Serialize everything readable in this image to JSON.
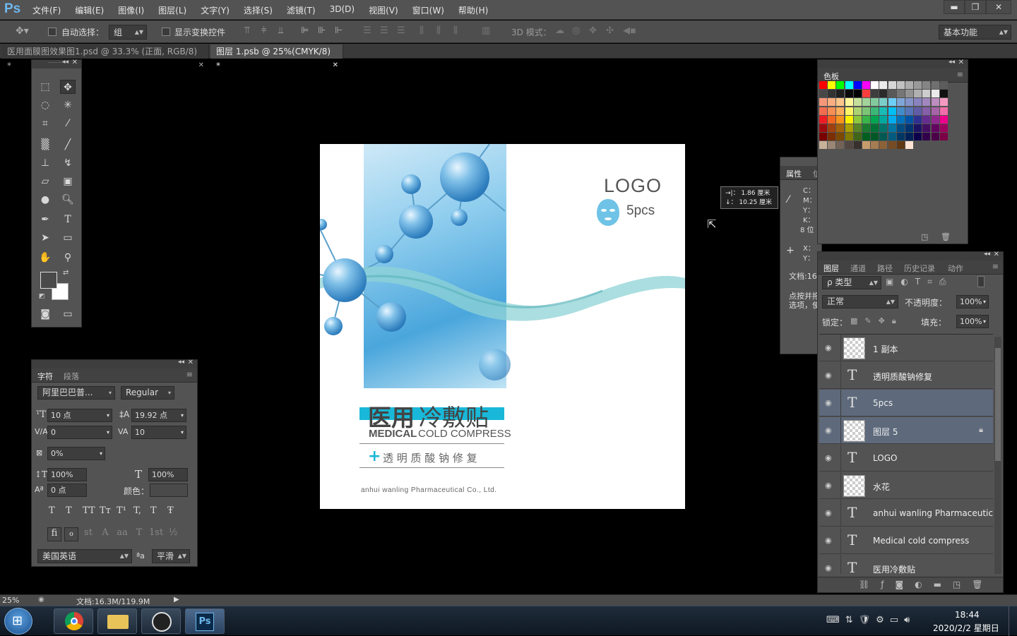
{
  "app": {
    "logo": "Ps",
    "menus": [
      "文件(F)",
      "编辑(E)",
      "图像(I)",
      "图层(L)",
      "文字(Y)",
      "选择(S)",
      "滤镜(T)",
      "3D(D)",
      "视图(V)",
      "窗口(W)",
      "帮助(H)"
    ],
    "win_min": "▬",
    "win_max": "❐",
    "win_close": "✕"
  },
  "options": {
    "auto_select": "自动选择：",
    "auto_select_value": "组",
    "show_transform": "显示变换控件",
    "mode_3d": "3D 模式：",
    "workspace": "基本功能"
  },
  "tabs": [
    {
      "label": "医用面膜图效果图1.psd @ 33.3% (正面, RGB/8) *",
      "close": "✕"
    },
    {
      "label": "图层 1.psb @ 25%(CMYK/8) *",
      "close": "✕"
    }
  ],
  "canvas": {
    "logo": "LOGO",
    "pcs": "5pcs",
    "title_bold": "医用",
    "title_light": "冷敷贴",
    "subtitle_bold": "MEDICAL",
    "subtitle_light": "COLD COMPRESS",
    "tagline_plus": "+",
    "tagline": "透 明 质 酸 钠 修 复",
    "company": "anhui wanling Pharmaceutical Co., Ltd."
  },
  "tooltip": {
    "line1": "→|：  1.86 厘米",
    "line2": "↓：  10.25 厘米"
  },
  "character": {
    "tabs": [
      "字符",
      "段落"
    ],
    "font_family": "阿里巴巴普...",
    "font_style": "Regular",
    "size": "10 点",
    "leading": "19.92 点",
    "kerning": "0",
    "tracking": "10",
    "scale_pct": "0%",
    "vscale": "100%",
    "hscale": "100%",
    "baseline": "0 点",
    "color_label": "颜色：",
    "language": "美国英语",
    "aa_label": "ªa",
    "antialias": "平滑",
    "styles": [
      "T",
      "T",
      "TT",
      "Tт",
      "T¹",
      "T,",
      "T",
      "Ŧ"
    ],
    "ot": [
      "fi",
      "ℴ",
      "st",
      "A",
      "aa",
      "T",
      "1st",
      "½"
    ]
  },
  "swatches": {
    "title": "色板"
  },
  "info": {
    "tabs": [
      "属性",
      "信"
    ],
    "c": "C：",
    "m": "M：",
    "y": "Y：",
    "k": "K：",
    "bits": "8 位",
    "x": "X：",
    "yy": "Y：",
    "doc": "文档:16",
    "hint1": "点按并拖",
    "hint2": "选项，使"
  },
  "layers": {
    "tabs": [
      "图层",
      "通道",
      "路径",
      "历史记录",
      "动作"
    ],
    "kind": "ρ 类型",
    "blend": "正常",
    "opacity_label": "不透明度：",
    "opacity": "100%",
    "lock_label": "锁定：",
    "fill_label": "填充：",
    "fill": "100%",
    "items": [
      {
        "name": "1 副本",
        "type": "pixel"
      },
      {
        "name": "透明质酸钠修复",
        "type": "text"
      },
      {
        "name": "5pcs",
        "type": "text",
        "selected": true
      },
      {
        "name": "图层 5",
        "type": "pixel",
        "selected": true,
        "locked": true
      },
      {
        "name": "LOGO",
        "type": "text"
      },
      {
        "name": "水花",
        "type": "pixel"
      },
      {
        "name": "anhui wanling Pharmaceutica...",
        "type": "text"
      },
      {
        "name": "Medical cold compress",
        "type": "text"
      },
      {
        "name": "医用冷敷贴",
        "type": "text"
      }
    ]
  },
  "status": {
    "zoom": "25%",
    "doc": "文档:16.3M/119.9M"
  },
  "taskbar": {
    "time": "18:44",
    "date": "2020/2/2 星期日"
  },
  "colors": {
    "ui_bg": "#535353",
    "accent_cyan": "#19b8d8",
    "ps_blue": "#6fb8ee"
  }
}
